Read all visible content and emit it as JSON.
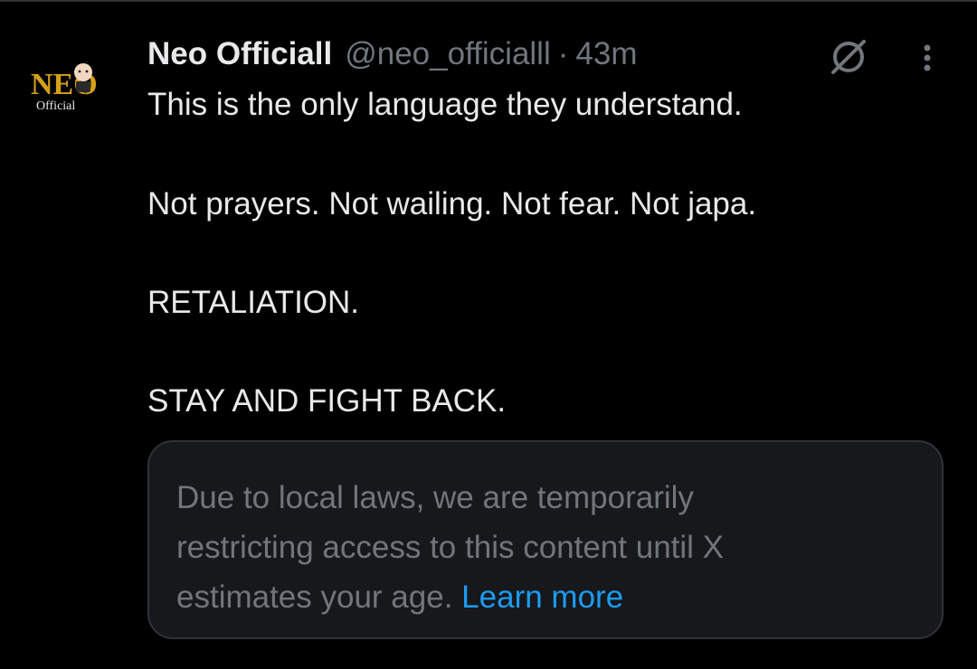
{
  "post": {
    "author": {
      "display_name": "Neo Officiall",
      "handle": "@neo_officialll",
      "avatar": {
        "logo_text": "NEO",
        "logo_subtext": "Official"
      }
    },
    "separator": "·",
    "timestamp": "43m",
    "actions": {
      "grok_icon": "grok-icon",
      "more_icon": "more-vertical-icon"
    },
    "text_lines": [
      "This is the only language they understand.",
      "Not prayers. Not wailing. Not fear. Not japa.",
      "RETALIATION.",
      "STAY AND FIGHT BACK."
    ]
  },
  "notice": {
    "lines": [
      "Due to local laws, we are temporarily",
      "restricting access to this content until X",
      "estimates your age."
    ],
    "link_text": "Learn more"
  },
  "colors": {
    "background": "#000000",
    "primary_text": "#e7e9ea",
    "secondary_text": "#71767b",
    "card_background": "#16181c",
    "card_border": "#2f3336",
    "link": "#1d9bf0",
    "logo_gold": "#d4a017"
  }
}
